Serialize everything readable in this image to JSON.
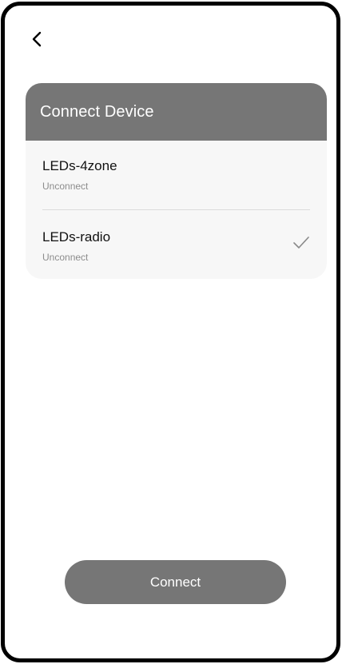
{
  "nav": {
    "back_icon": "chevron-left-icon"
  },
  "card": {
    "title": "Connect Device",
    "header_color": "#767676",
    "devices": [
      {
        "name": "LEDs-4zone",
        "status": "Unconnect",
        "selected": false
      },
      {
        "name": "LEDs-radio",
        "status": "Unconnect",
        "selected": true
      }
    ],
    "selected_icon": "check-icon"
  },
  "footer": {
    "connect_label": "Connect",
    "button_color": "#767676"
  }
}
